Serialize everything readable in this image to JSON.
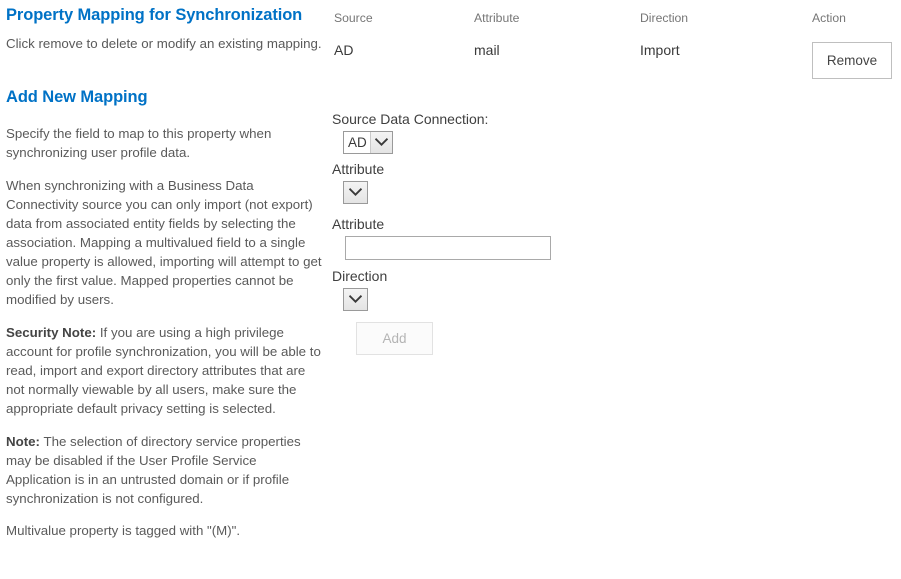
{
  "existing_mapping": {
    "title": "Property Mapping for Synchronization",
    "description": "Click remove to delete or modify an existing mapping.",
    "columns": {
      "source": "Source",
      "attribute": "Attribute",
      "direction": "Direction",
      "action": "Action"
    },
    "rows": [
      {
        "source": "AD",
        "attribute": "mail",
        "direction": "Import",
        "action_label": "Remove"
      }
    ]
  },
  "add_new_mapping": {
    "title": "Add New Mapping",
    "paragraphs": {
      "p1": "Specify the field to map to this property when synchronizing user profile data.",
      "p2": "When synchronizing with a Business Data Connectivity source you can only import (not export) data from associated entity fields by selecting  the association. Mapping a multivalued field to a single value property is allowed, importing will attempt to get only the first value. Mapped properties cannot be modified by users.",
      "security_note_label": "Security Note:",
      "p3": "If you are using a high privilege account for profile synchronization, you will be able to read, import and export directory attributes that are not normally viewable by all users, make sure the appropriate default privacy setting is selected.",
      "note_label": "Note:",
      "p4": "The selection of directory service properties may be disabled if the User Profile Service Application is in an untrusted domain or if profile synchronization is not configured.",
      "p5": "Multivalue property is tagged with \"(M)\"."
    },
    "form": {
      "source_data_connection": {
        "label": "Source Data Connection:",
        "value": "AD"
      },
      "attribute_select": {
        "label": "Attribute",
        "value": ""
      },
      "attribute_text": {
        "label": "Attribute",
        "value": "",
        "placeholder": ""
      },
      "direction_select": {
        "label": "Direction",
        "value": ""
      },
      "add_button": {
        "label": "Add",
        "disabled": true
      }
    }
  },
  "colors": {
    "accent": "#0072C6",
    "body_text": "#5a5a5a",
    "header_text": "#767676"
  }
}
